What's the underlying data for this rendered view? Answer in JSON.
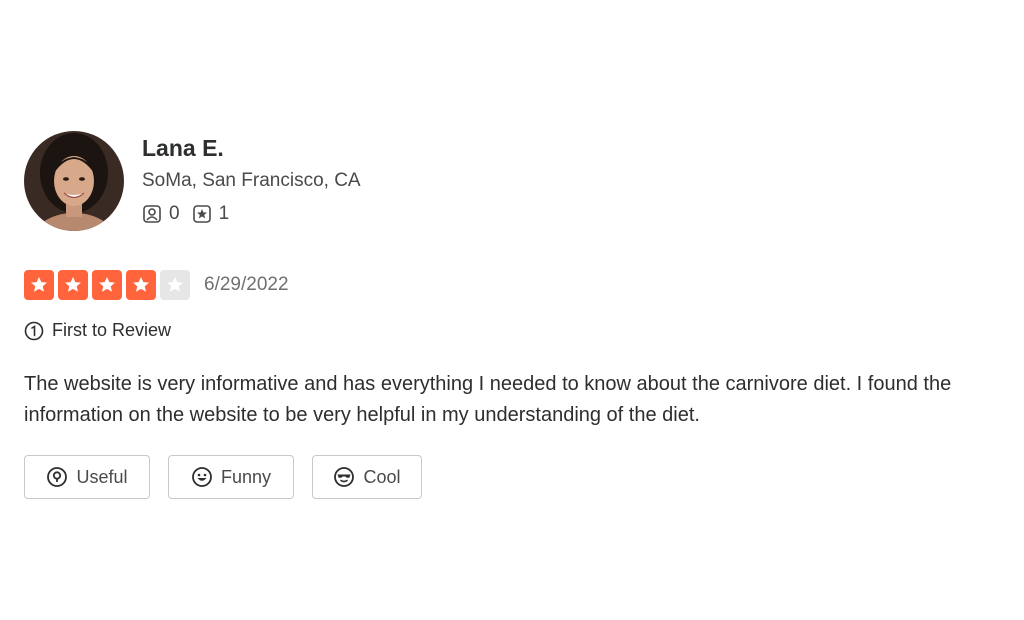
{
  "reviewer": {
    "name": "Lana E.",
    "location": "SoMa, San Francisco, CA",
    "friends_count": "0",
    "reviews_count": "1"
  },
  "review": {
    "rating": 4,
    "max_rating": 5,
    "date": "6/29/2022",
    "badge": "First to Review",
    "text": "The website is very informative and has everything I needed to know about the carnivore diet. I found the information on the website to be very helpful in my understanding of the diet."
  },
  "reactions": {
    "useful_label": "Useful",
    "funny_label": "Funny",
    "cool_label": "Cool"
  },
  "colors": {
    "star_filled": "#ff643d",
    "star_empty": "#e6e6e6"
  }
}
